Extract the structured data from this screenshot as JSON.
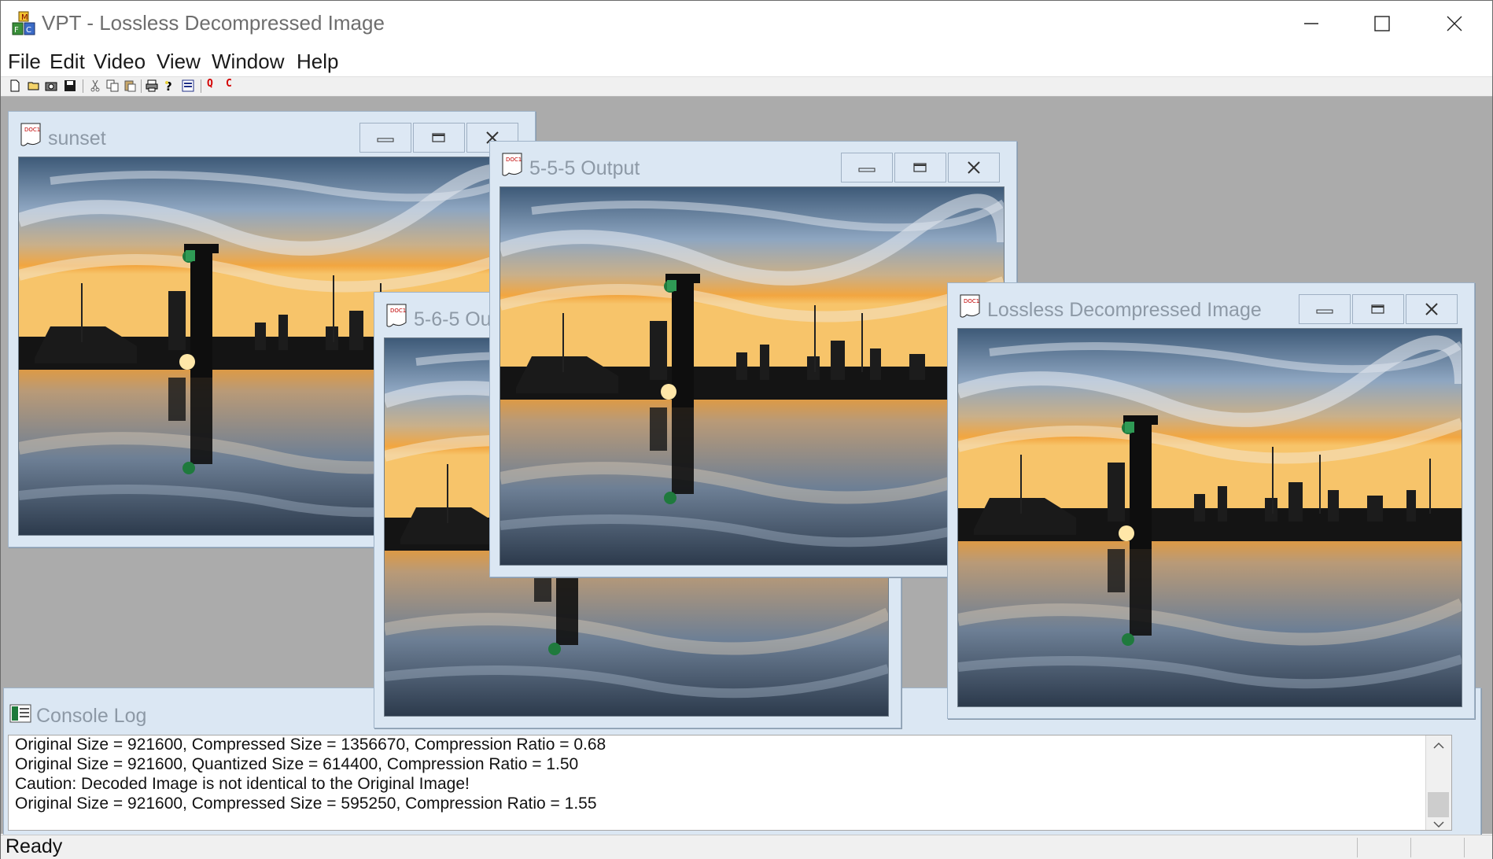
{
  "window": {
    "title": "VPT - Lossless Decompressed Image",
    "minimize_icon": "minimize-icon",
    "maximize_icon": "maximize-icon",
    "close_icon": "close-icon"
  },
  "menu": [
    "File",
    "Edit",
    "Video",
    "View",
    "Window",
    "Help"
  ],
  "toolbar": {
    "icons": [
      "new-icon",
      "open-icon",
      "camera-icon",
      "save-icon",
      "cut-icon",
      "copy-icon",
      "paste-icon",
      "print-icon",
      "help-icon",
      "about-icon"
    ],
    "q_label": "Q",
    "c_label": "C"
  },
  "child_windows": {
    "sunset": {
      "title": "sunset"
    },
    "out565": {
      "title": "5-6-5 Output",
      "visible_title": "5-6-5 Ou"
    },
    "out555": {
      "title": "5-5-5 Output"
    },
    "lossless": {
      "title": "Lossless Decompressed Image"
    },
    "console": {
      "title": "Console Log"
    }
  },
  "console_log": [
    "Original Size = 921600, Compressed Size = 1356670, Compression Ratio = 0.68",
    "Original Size = 921600, Quantized Size = 614400, Compression Ratio = 1.50",
    "Caution: Decoded Image is not identical to the Original Image!",
    "Original Size = 921600, Compressed Size = 595250, Compression Ratio = 1.55"
  ],
  "status": "Ready",
  "colors": {
    "mdi_background": "#ababab",
    "child_caption": "#dbe7f3",
    "child_title_text": "#8d99a6",
    "toolbar_red": "#d40000"
  }
}
